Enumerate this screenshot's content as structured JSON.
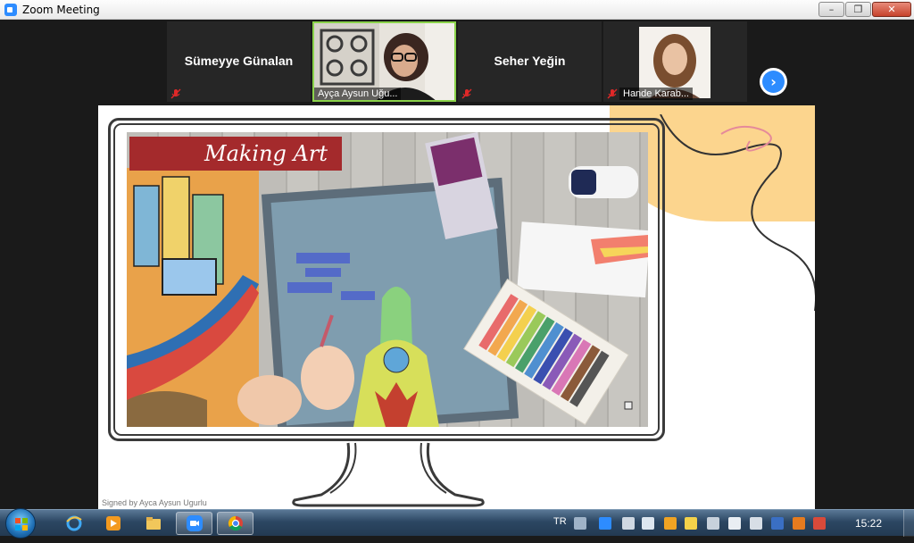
{
  "window": {
    "title": "Zoom Meeting",
    "minimize_label": "–",
    "maximize_label": "❐",
    "close_label": "✕"
  },
  "participants": [
    {
      "name": "Sümeyye Günalan",
      "muted": true,
      "video": false
    },
    {
      "name": "Ayça Aysun Uğu...",
      "muted": false,
      "video": true,
      "active_speaker": true
    },
    {
      "name": "Seher Yeğin",
      "muted": true,
      "video": false
    },
    {
      "name": "Hande Karab...",
      "muted": true,
      "video": true
    }
  ],
  "next_page_label": "›",
  "slide": {
    "video_title": "Making Art",
    "signature": "Signed by Ayca Aysun Ugurlu"
  },
  "taskbar": {
    "language": "TR",
    "clock": "15:22",
    "apps": [
      "internet-explorer",
      "media-player",
      "file-explorer",
      "zoom",
      "chrome"
    ]
  },
  "colors": {
    "accent_blue": "#2d8cff",
    "active_speaker_border": "#8bd34a",
    "title_banner_red": "#a42a2c",
    "slide_yellow": "#fcd58e"
  }
}
